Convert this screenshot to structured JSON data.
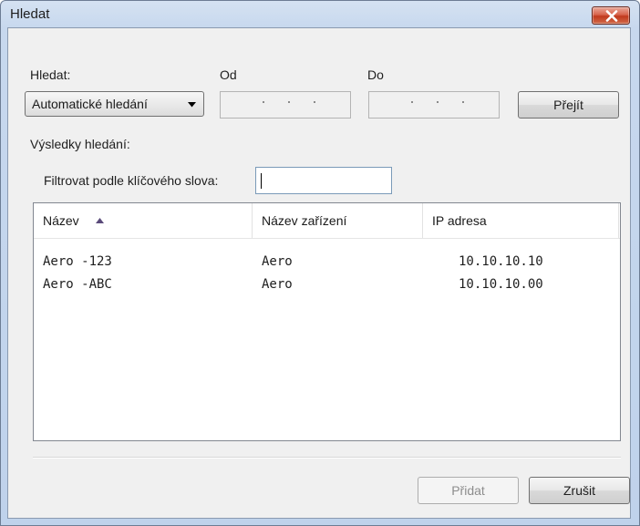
{
  "window": {
    "title": "Hledat"
  },
  "search": {
    "label": "Hledat:",
    "mode": "Automatické hledání",
    "from_label": "Od",
    "to_label": "Do",
    "go_label": "Přejít"
  },
  "results": {
    "label": "Výsledky hledání:",
    "filter_label": "Filtrovat podle klíčového slova:",
    "filter_value": ""
  },
  "table": {
    "columns": [
      "Název",
      "Název zařízení",
      "IP adresa"
    ],
    "sort_column": "Název",
    "rows": [
      [
        "Aero -123",
        "Aero",
        "10.10.10.10"
      ],
      [
        "Aero -ABC",
        "Aero",
        "10.10.10.00"
      ]
    ]
  },
  "footer": {
    "add_label": "Přidat",
    "cancel_label": "Zrušit"
  },
  "colors": {
    "frame": "#c7d8ee",
    "client": "#f0f0f0",
    "close": "#c0391d"
  }
}
